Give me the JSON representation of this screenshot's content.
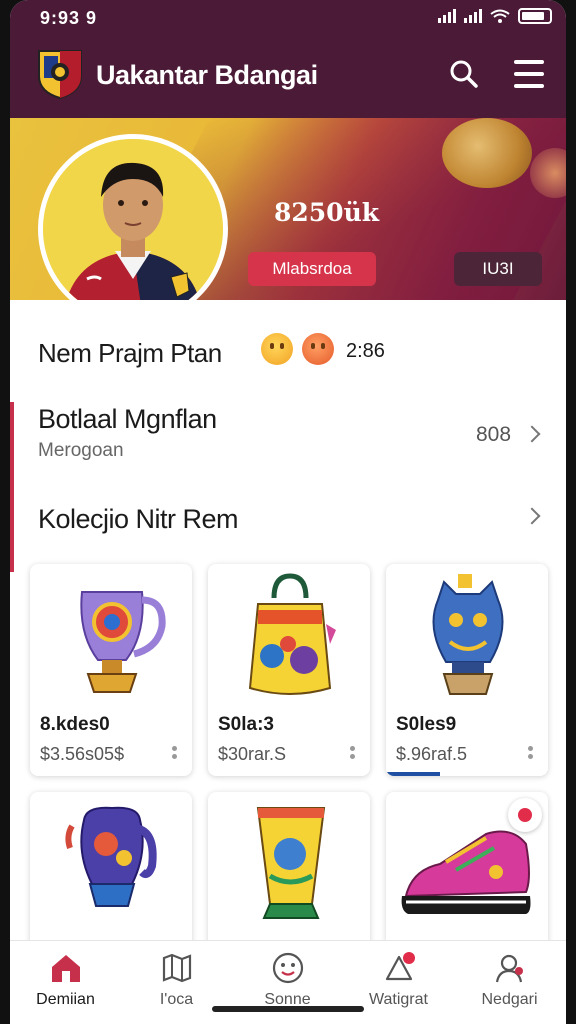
{
  "status_bar": {
    "time": "9:93 9"
  },
  "app_bar": {
    "title": "Uakantar Bdangai",
    "icons": [
      "crest-logo",
      "search-icon",
      "menu-icon"
    ]
  },
  "hero": {
    "stat": "8250ük",
    "primary_button": "Mlabsrdoa",
    "secondary_button": "IU3I"
  },
  "profile": {
    "name": "Nem Prajm Ptan",
    "time": "2:86"
  },
  "section_1": {
    "title": "Botlaal Mgnflan",
    "subtitle": "Merogoan",
    "count": "808"
  },
  "section_2": {
    "title": "Kolecjio Nitr Rem"
  },
  "products": [
    {
      "title": "8.kdes0",
      "price": "$3.56s05$",
      "icon": "trophy-vase"
    },
    {
      "title": "S0la:3",
      "price": "$30rar.S",
      "icon": "painted-jar"
    },
    {
      "title": "S0les9",
      "price": "$.96raf.5",
      "icon": "cat-vase"
    },
    {
      "title": "",
      "price": "",
      "icon": "elephant-vase"
    },
    {
      "title": "",
      "price": "",
      "icon": "painted-cup"
    },
    {
      "title": "",
      "price": "",
      "icon": "sneaker"
    }
  ],
  "bottom_nav": [
    {
      "label": "Demiian",
      "icon": "home-icon",
      "active": true
    },
    {
      "label": "I'oca",
      "icon": "map-icon",
      "active": false
    },
    {
      "label": "Sonne",
      "icon": "smile-icon",
      "active": false
    },
    {
      "label": "Watigrat",
      "icon": "notification-icon",
      "active": false
    },
    {
      "label": "Nedgari",
      "icon": "profile-icon",
      "active": false
    }
  ],
  "colors": {
    "app_bar": "#4a1a36",
    "accent_red": "#d6344a",
    "accent_blue": "#1f4fa3",
    "hero_gold": "#e9c23e"
  }
}
